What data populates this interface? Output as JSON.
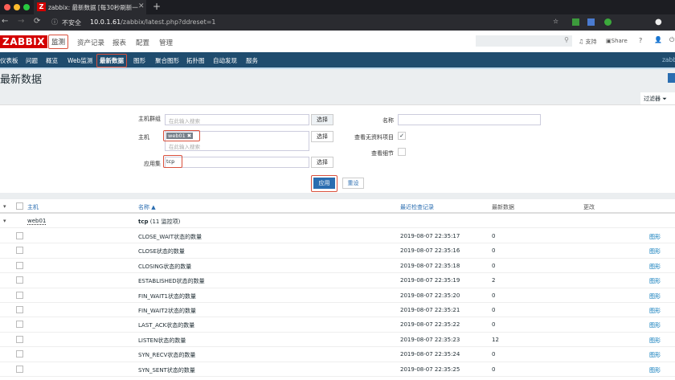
{
  "browser": {
    "tab_title": "zabbix: 最新数据 [每30秒刷新一",
    "security": "不安全",
    "url_host": "10.0.1.61",
    "url_path": "/zabbix/latest.php?ddreset=1"
  },
  "header": {
    "logo": "ZABBIX",
    "menu": [
      "监测",
      "资产记录",
      "报表",
      "配置",
      "管理"
    ],
    "support": "支持",
    "share": "Share",
    "help": "?",
    "user": "zabbix"
  },
  "nav": [
    "仪表板",
    "问题",
    "概览",
    "Web监测",
    "最新数据",
    "图形",
    "聚合图形",
    "拓扑图",
    "自动发现",
    "服务"
  ],
  "page_title": "最新数据",
  "filter": {
    "tab_label": "过滤器",
    "host_group_label": "主机群组",
    "host_group_placeholder": "在此输入搜索",
    "host_label": "主机",
    "host_tag": "web01",
    "host_placeholder": "在此输入搜索",
    "app_label": "应用集",
    "app_value": "tcp",
    "select": "选择",
    "name_label": "名称",
    "show_no_data_label": "查看无资料项目",
    "show_no_data": true,
    "details_label": "查看细节",
    "details": false,
    "apply": "应用",
    "reset": "重设"
  },
  "table": {
    "headers": {
      "host": "主机",
      "name": "名称 ▲",
      "last_check": "最近检查记录",
      "last_value": "最新数据",
      "change": "更改"
    },
    "host": "web01",
    "app_group": "tcp",
    "app_count": "(11 监控项)",
    "graph_link": "图形",
    "rows": [
      {
        "name": "CLOSE_WAIT状态的数量",
        "time": "2019-08-07 22:35:17",
        "value": "0"
      },
      {
        "name": "CLOSE状态的数量",
        "time": "2019-08-07 22:35:16",
        "value": "0"
      },
      {
        "name": "CLOSING状态的数量",
        "time": "2019-08-07 22:35:18",
        "value": "0"
      },
      {
        "name": "ESTABLISHED状态的数量",
        "time": "2019-08-07 22:35:19",
        "value": "2"
      },
      {
        "name": "FIN_WAIT1状态的数量",
        "time": "2019-08-07 22:35:20",
        "value": "0"
      },
      {
        "name": "FIN_WAIT2状态的数量",
        "time": "2019-08-07 22:35:21",
        "value": "0"
      },
      {
        "name": "LAST_ACK状态的数量",
        "time": "2019-08-07 22:35:22",
        "value": "0"
      },
      {
        "name": "LISTEN状态的数量",
        "time": "2019-08-07 22:35:23",
        "value": "12"
      },
      {
        "name": "SYN_RECV状态的数量",
        "time": "2019-08-07 22:35:24",
        "value": "0"
      },
      {
        "name": "SYN_SENT状态的数量",
        "time": "2019-08-07 22:35:25",
        "value": "0"
      }
    ]
  }
}
